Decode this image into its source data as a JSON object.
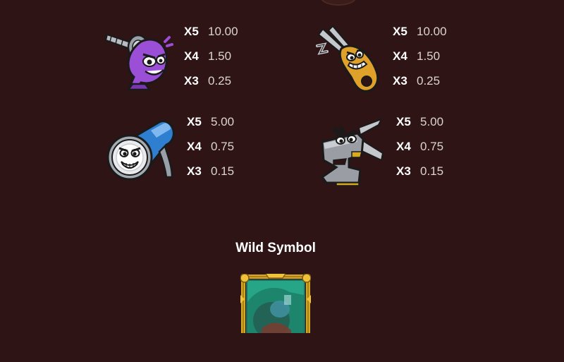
{
  "paytable": {
    "symbols": [
      {
        "name": "purple drill",
        "icon": "purple-drill-icon",
        "color": "#9b4fd6",
        "payouts": [
          {
            "mult": "X5",
            "value": "10.00"
          },
          {
            "mult": "X4",
            "value": "1.50"
          },
          {
            "mult": "X3",
            "value": "0.25"
          }
        ]
      },
      {
        "name": "gold pliers",
        "icon": "gold-pliers-icon",
        "color": "#e0a12a",
        "payouts": [
          {
            "mult": "X5",
            "value": "10.00"
          },
          {
            "mult": "X4",
            "value": "1.50"
          },
          {
            "mult": "X3",
            "value": "0.25"
          }
        ]
      },
      {
        "name": "blue flashlight",
        "icon": "blue-flashlight-icon",
        "color": "#2f7fd0",
        "payouts": [
          {
            "mult": "X5",
            "value": "5.00"
          },
          {
            "mult": "X4",
            "value": "0.75"
          },
          {
            "mult": "X3",
            "value": "0.15"
          }
        ]
      },
      {
        "name": "grey vise",
        "icon": "grey-vise-icon",
        "color": "#9a9ea4",
        "payouts": [
          {
            "mult": "X5",
            "value": "5.00"
          },
          {
            "mult": "X4",
            "value": "0.75"
          },
          {
            "mult": "X3",
            "value": "0.15"
          }
        ]
      }
    ]
  },
  "wild": {
    "title": "Wild Symbol",
    "icon": "wild-frame-icon",
    "frame_color": "#d8a823",
    "inner_color": "#27a687"
  }
}
